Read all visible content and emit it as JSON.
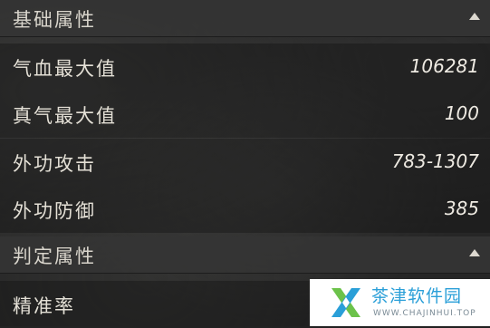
{
  "sections": {
    "basic": {
      "title": "基础属性",
      "collapse_icon": "triangle-up-icon",
      "rows": [
        {
          "label": "气血最大值",
          "value": "106281"
        },
        {
          "label": "真气最大值",
          "value": "100"
        },
        {
          "label": "外功攻击",
          "value": "783-1307"
        },
        {
          "label": "外功防御",
          "value": "385"
        }
      ]
    },
    "judgement": {
      "title": "判定属性",
      "collapse_icon": "triangle-up-icon",
      "rows": [
        {
          "label": "精准率",
          "value": ""
        }
      ]
    }
  },
  "watermark": {
    "title": "茶津软件园",
    "url": "WWW.CHAJINHUI.TOP",
    "logo_icon": "x-logo-icon",
    "colors": {
      "logo_green": "#6cc24a",
      "logo_blue": "#2a9fd8"
    }
  },
  "colors": {
    "header_bg": "#343434",
    "label_text": "#e4e0d6",
    "value_text": "#eeeae2"
  }
}
